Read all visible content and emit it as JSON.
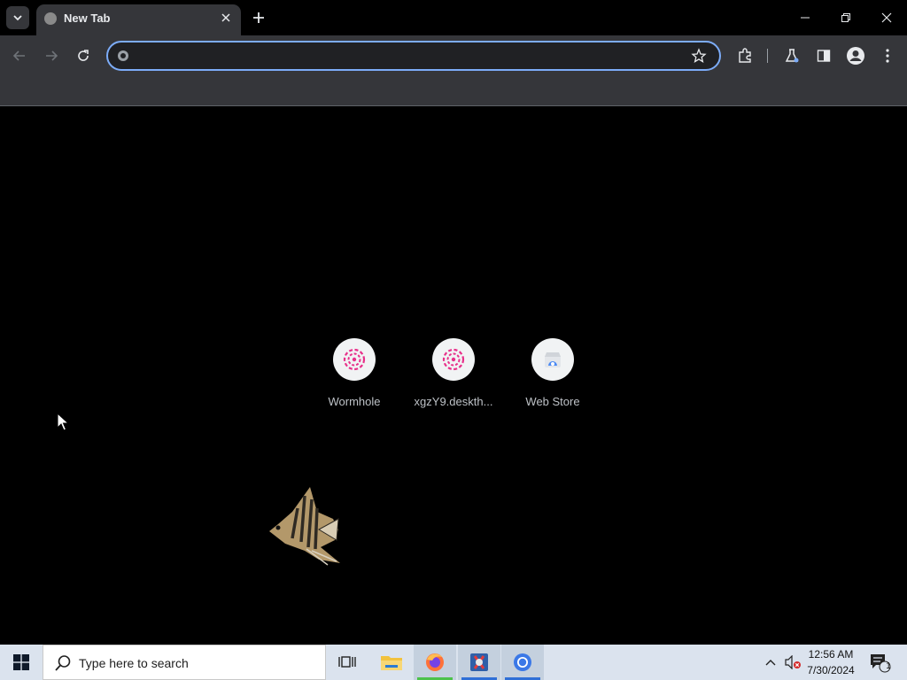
{
  "browser": {
    "tab": {
      "title": "New Tab"
    },
    "omnibox": {
      "value": "",
      "placeholder": ""
    }
  },
  "shortcuts": [
    {
      "label": "Wormhole",
      "icon": "wormhole-icon"
    },
    {
      "label": "xgzY9.deskth...",
      "icon": "wormhole-icon"
    },
    {
      "label": "Web Store",
      "icon": "web-store-icon"
    }
  ],
  "taskbar": {
    "search_placeholder": "Type here to search",
    "time": "12:56 AM",
    "date": "7/30/2024",
    "notification_count": "1"
  },
  "colors": {
    "accent": "#7cacf8",
    "toolbar": "#35363a",
    "page_background": "#000000",
    "wormhole_pink": "#e8308a",
    "taskbar": "#dbe3ee"
  }
}
